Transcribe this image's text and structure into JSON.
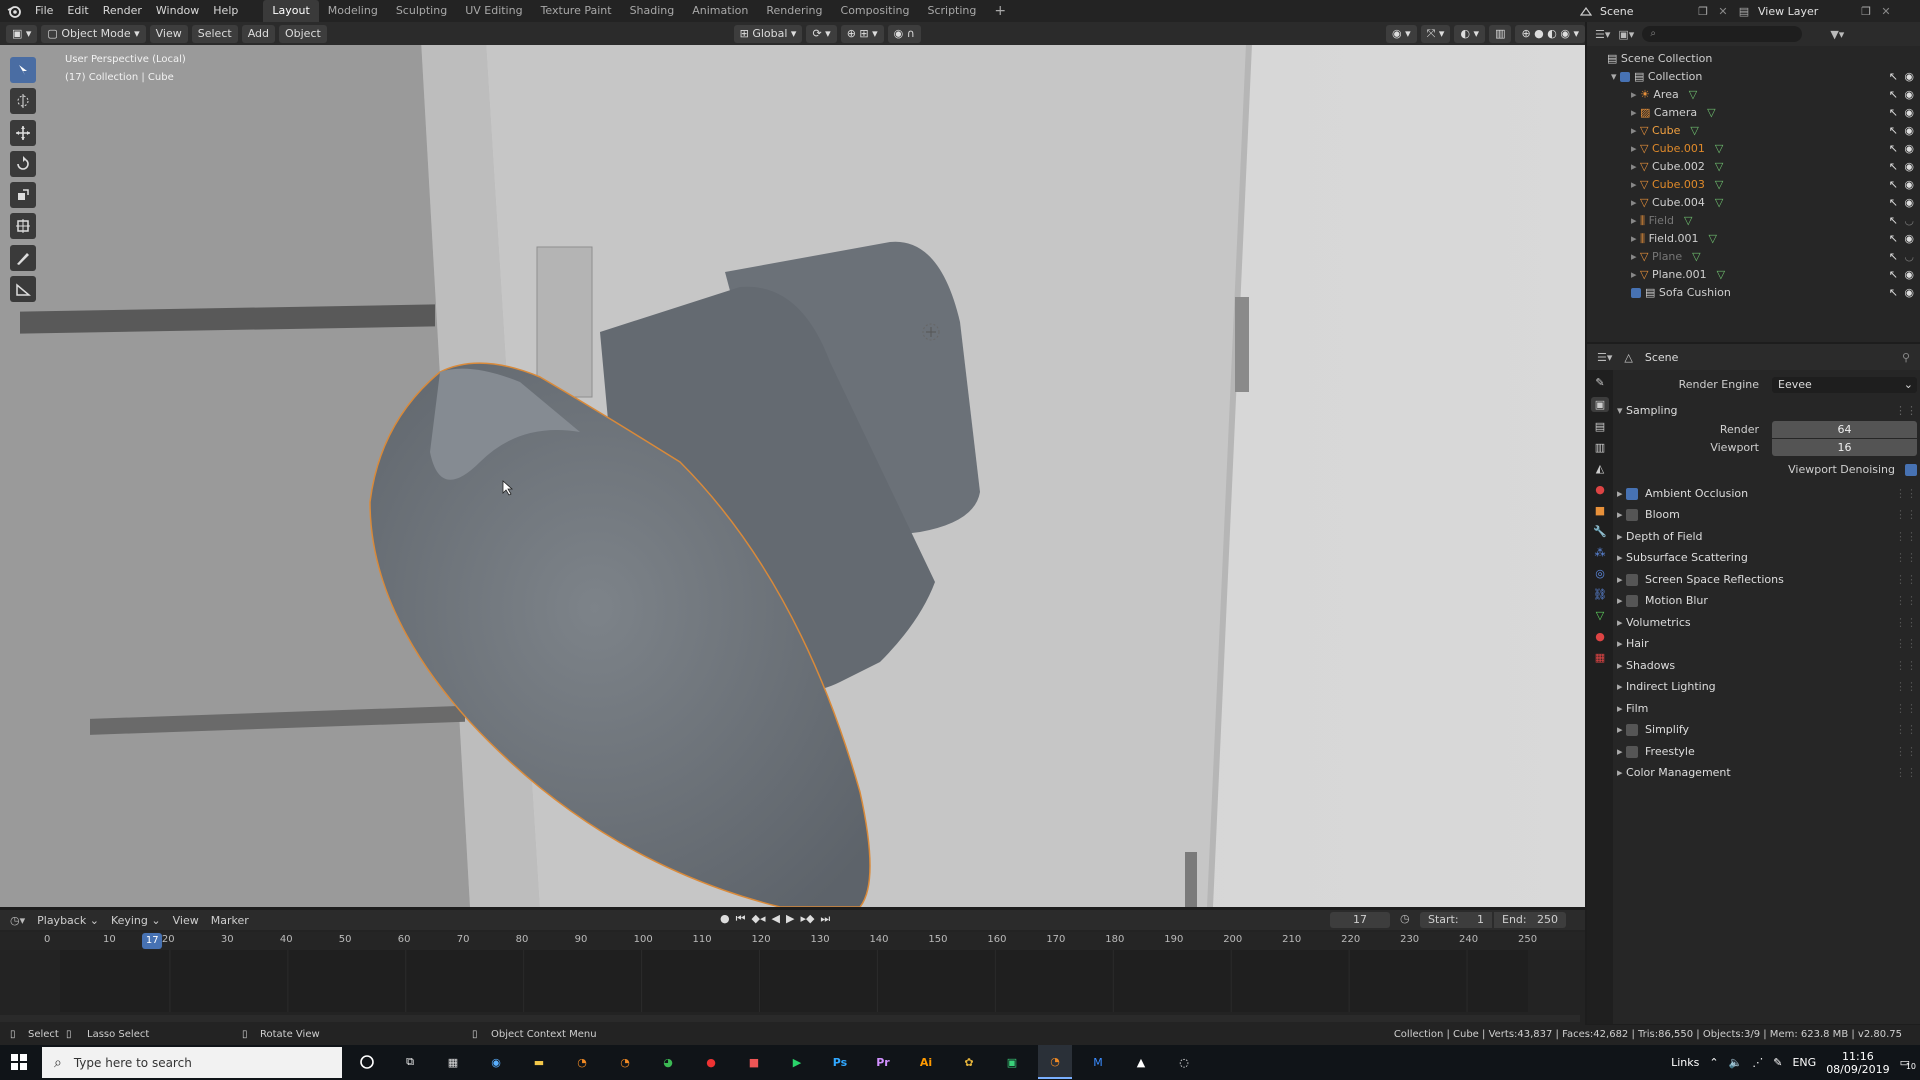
{
  "topbar": {
    "menus": [
      "File",
      "Edit",
      "Render",
      "Window",
      "Help"
    ],
    "workspaces": [
      "Layout",
      "Modeling",
      "Sculpting",
      "UV Editing",
      "Texture Paint",
      "Shading",
      "Animation",
      "Rendering",
      "Compositing",
      "Scripting"
    ],
    "active_workspace": "Layout",
    "scene": "Scene",
    "view_layer": "View Layer"
  },
  "viewport_header": {
    "mode": "Object Mode",
    "menus": [
      "View",
      "Select",
      "Add",
      "Object"
    ],
    "orientation": "Global"
  },
  "viewport": {
    "perspective": "User Perspective (Local)",
    "collection_info": "(17) Collection | Cube"
  },
  "outliner": {
    "root": "Scene Collection",
    "collection": "Collection",
    "items": [
      {
        "name": "Area",
        "color": "#cfcfcf"
      },
      {
        "name": "Camera",
        "color": "#cfcfcf"
      },
      {
        "name": "Cube",
        "color": "#f0a040"
      },
      {
        "name": "Cube.001",
        "color": "#e08a2a"
      },
      {
        "name": "Cube.002",
        "color": "#cfcfcf"
      },
      {
        "name": "Cube.003",
        "color": "#e08a2a"
      },
      {
        "name": "Cube.004",
        "color": "#cfcfcf"
      },
      {
        "name": "Field",
        "color": "#777777"
      },
      {
        "name": "Field.001",
        "color": "#cfcfcf"
      },
      {
        "name": "Plane",
        "color": "#777777"
      },
      {
        "name": "Plane.001",
        "color": "#cfcfcf"
      }
    ],
    "extra": "Sofa Cushion"
  },
  "properties": {
    "context": "Scene",
    "render_engine_label": "Render Engine",
    "render_engine": "Eevee",
    "sampling": "Sampling",
    "render_label": "Render",
    "render_value": "64",
    "viewport_label": "Viewport",
    "viewport_value": "16",
    "viewport_denoising": "Viewport Denoising",
    "panels": [
      {
        "label": "Ambient Occlusion",
        "checkbox": true,
        "checked": true
      },
      {
        "label": "Bloom",
        "checkbox": true,
        "checked": false
      },
      {
        "label": "Depth of Field",
        "checkbox": false
      },
      {
        "label": "Subsurface Scattering",
        "checkbox": false
      },
      {
        "label": "Screen Space Reflections",
        "checkbox": true,
        "checked": false
      },
      {
        "label": "Motion Blur",
        "checkbox": true,
        "checked": false
      },
      {
        "label": "Volumetrics",
        "checkbox": false
      },
      {
        "label": "Hair",
        "checkbox": false
      },
      {
        "label": "Shadows",
        "checkbox": false
      },
      {
        "label": "Indirect Lighting",
        "checkbox": false
      },
      {
        "label": "Film",
        "checkbox": false
      },
      {
        "label": "Simplify",
        "checkbox": true,
        "checked": false
      },
      {
        "label": "Freestyle",
        "checkbox": true,
        "checked": false
      },
      {
        "label": "Color Management",
        "checkbox": false
      }
    ]
  },
  "timeline": {
    "menus": [
      "Playback",
      "Keying",
      "View",
      "Marker"
    ],
    "current_frame": "17",
    "start_label": "Start:",
    "start": "1",
    "end_label": "End:",
    "end": "250",
    "ruler": [
      "0",
      "10",
      "20",
      "30",
      "40",
      "50",
      "60",
      "70",
      "80",
      "90",
      "100",
      "110",
      "120",
      "130",
      "140",
      "150",
      "160",
      "170",
      "180",
      "190",
      "200",
      "210",
      "220",
      "230",
      "240",
      "250"
    ],
    "playhead_label": "17"
  },
  "statusbar": {
    "select": "Select",
    "lasso": "Lasso Select",
    "rotate": "Rotate View",
    "context_menu": "Object Context Menu",
    "stats": "Collection | Cube | Verts:43,837 | Faces:42,682 | Tris:86,550 | Objects:3/9 | Mem: 623.8 MB | v2.80.75"
  },
  "taskbar": {
    "search_placeholder": "Type here to search",
    "links": "Links",
    "lang": "ENG",
    "time": "11:16",
    "date": "08/09/2019",
    "notifications": "10"
  }
}
